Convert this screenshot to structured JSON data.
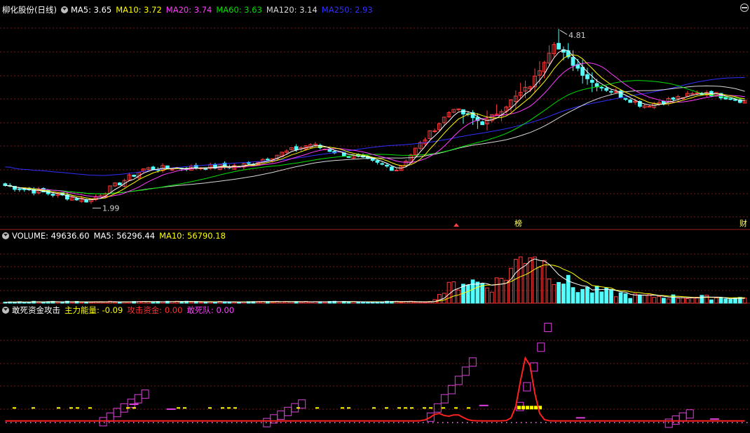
{
  "colors": {
    "up": "#ff3c3c",
    "down": "#54ffff",
    "grid": "#7a1a1a",
    "divider": "#a02020",
    "ma5": "#ffffff",
    "ma10": "#ffff00",
    "ma20": "#ff3cff",
    "ma60": "#00e000",
    "ma120": "#d8d8d8",
    "ma250": "#3030ff",
    "energy": "#ff2020",
    "attack": "#ffff00",
    "dare": "#e040e0"
  },
  "price_panel": {
    "stock_name": "柳化股份(日线)",
    "ma_labels": [
      {
        "key": "MA5",
        "text": "MA5: 3.65",
        "color": "#ffffff"
      },
      {
        "key": "MA10",
        "text": "MA10: 3.72",
        "color": "#ffff00"
      },
      {
        "key": "MA20",
        "text": "MA20: 3.74",
        "color": "#ff3cff"
      },
      {
        "key": "MA60",
        "text": "MA60: 3.63",
        "color": "#00e000"
      },
      {
        "key": "MA120",
        "text": "MA120: 3.14",
        "color": "#d8d8d8"
      },
      {
        "key": "MA250",
        "text": "MA250: 2.93",
        "color": "#3030ff"
      }
    ],
    "high_label": "4.81",
    "low_label": "1.99",
    "badge_bang": "榜",
    "badge_cai": "财",
    "corner_icon": "zoom-out-icon"
  },
  "volume_panel": {
    "labels": [
      {
        "text": "VOLUME: 49636.60",
        "color": "#ffffff"
      },
      {
        "text": "MA5: 56296.44",
        "color": "#ffffff"
      },
      {
        "text": "MA10: 56790.18",
        "color": "#ffff00"
      }
    ]
  },
  "indicator_panel": {
    "labels": [
      {
        "text": "敢死资金攻击",
        "color": "#ffffff"
      },
      {
        "text": "主力能量: -0.09",
        "color": "#ffff00"
      },
      {
        "text": "攻击资金: 0.00",
        "color": "#ff3030"
      },
      {
        "text": "敢死队: 0.00",
        "color": "#ff40ff"
      }
    ]
  },
  "chart_data": {
    "type": "candlestick",
    "price_range": [
      1.6,
      5.05
    ],
    "high_price": 4.81,
    "low_price": 1.99,
    "price_segments": [
      {
        "n": 18,
        "end": 2.05
      },
      {
        "n": 12,
        "end": 2.55
      },
      {
        "n": 20,
        "end": 2.6
      },
      {
        "n": 15,
        "end": 2.95
      },
      {
        "n": 18,
        "end": 2.55
      },
      {
        "n": 12,
        "end": 3.55
      },
      {
        "n": 6,
        "end": 3.3
      },
      {
        "n": 10,
        "end": 3.9
      },
      {
        "n": 5,
        "end": 4.6
      },
      {
        "n": 8,
        "end": 3.95
      },
      {
        "n": 10,
        "end": 3.6
      },
      {
        "n": 14,
        "end": 3.8
      },
      {
        "n": 8,
        "end": 3.65
      }
    ],
    "volume_max": 230000,
    "volume_markers": [
      {
        "t": 0.58,
        "v": 22000
      },
      {
        "t": 0.6,
        "v": 60000
      },
      {
        "t": 0.62,
        "v": 90000
      },
      {
        "t": 0.66,
        "v": 70000
      },
      {
        "t": 0.69,
        "v": 150000
      },
      {
        "t": 0.71,
        "v": 230000
      },
      {
        "t": 0.73,
        "v": 150000
      },
      {
        "t": 0.77,
        "v": 60000
      },
      {
        "t": 0.85,
        "v": 28000
      },
      {
        "t": 1.0,
        "v": 20000
      }
    ],
    "indicator_range": [
      -0.3,
      4.3
    ],
    "dare_steps": [
      {
        "t": 0.13,
        "n": 7,
        "top": 1.3
      },
      {
        "t": 0.35,
        "n": 6,
        "top": 0.9
      },
      {
        "t": 0.57,
        "n": 7,
        "top": 2.6
      },
      {
        "t": 0.69,
        "n": 5,
        "top": 4.0
      },
      {
        "t": 0.89,
        "n": 4,
        "top": 0.5
      }
    ],
    "energy_spikes": [
      {
        "t": 0.585,
        "h": 0.3
      },
      {
        "t": 0.61,
        "h": 0.25
      },
      {
        "t": 0.705,
        "h": 2.6
      }
    ]
  }
}
